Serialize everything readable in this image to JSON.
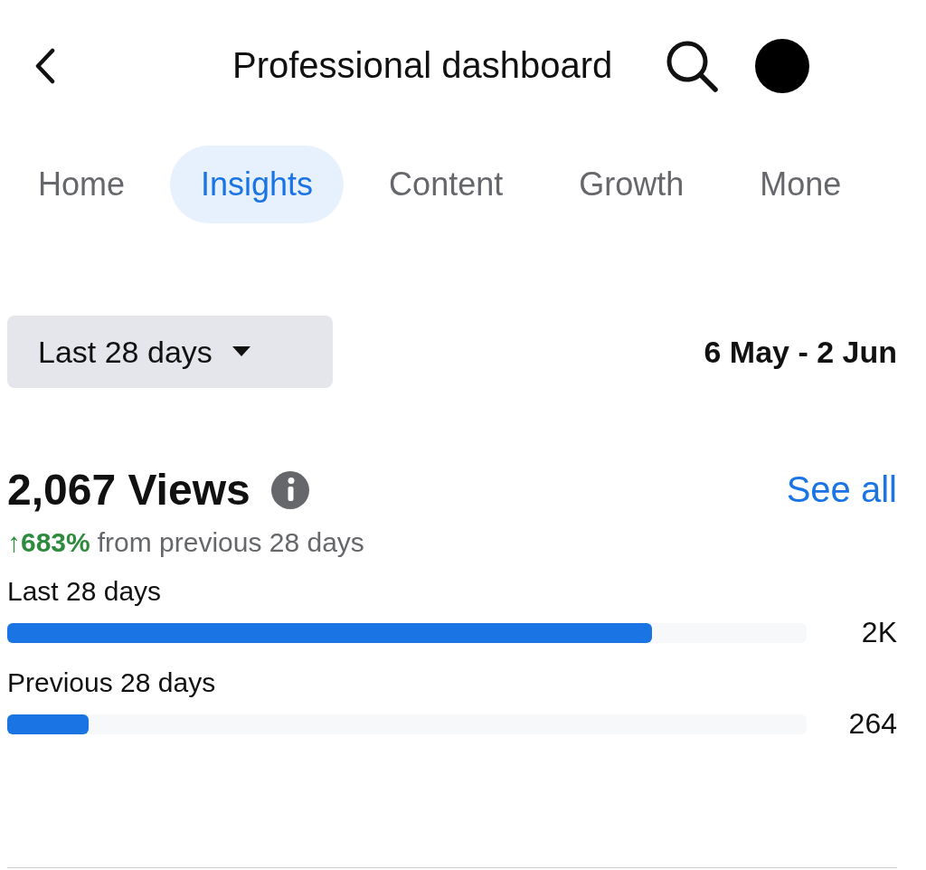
{
  "header": {
    "title": "Professional dashboard"
  },
  "tabs": [
    {
      "label": "Home",
      "selected": false
    },
    {
      "label": "Insights",
      "selected": true
    },
    {
      "label": "Content",
      "selected": false
    },
    {
      "label": "Growth",
      "selected": false
    },
    {
      "label": "Mone",
      "selected": false
    }
  ],
  "period": {
    "dropdown": "Last 28 days",
    "range": "6 May - 2 Jun"
  },
  "views": {
    "title": "2,067 Views",
    "link": "See all",
    "change": "↑683%",
    "change_text": "from previous 28 days"
  },
  "bars": [
    {
      "label": "Last 28 days",
      "level": 0.806,
      "value": "2K"
    },
    {
      "label": "Previous 28 days",
      "level": 0.102,
      "value": "264"
    }
  ]
}
